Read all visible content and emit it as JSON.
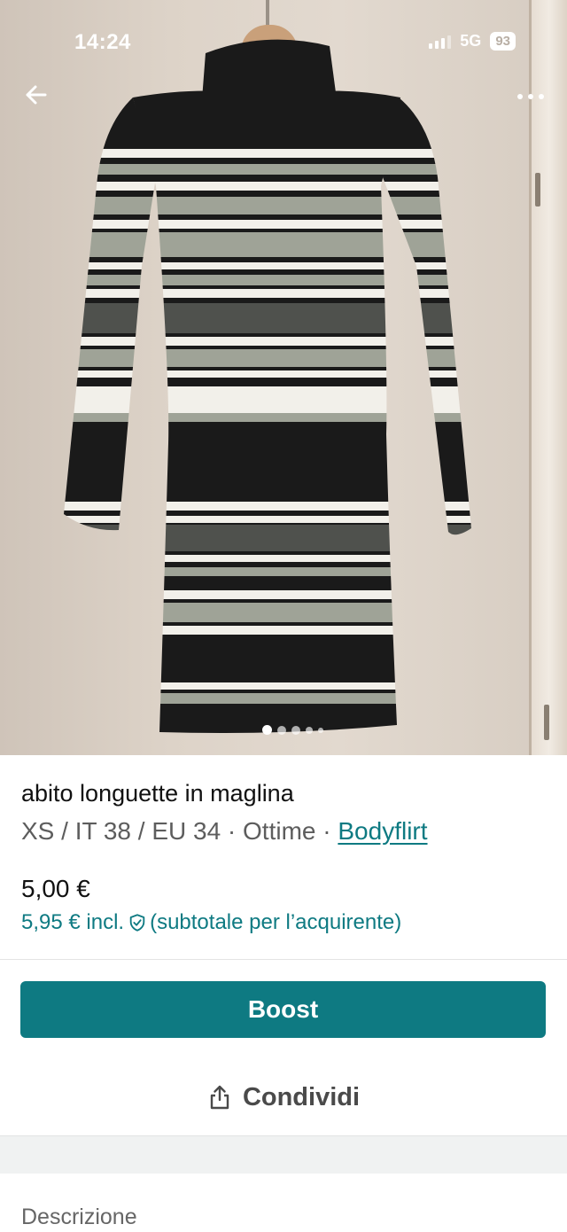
{
  "status_bar": {
    "time": "14:24",
    "network": "5G",
    "battery": "93"
  },
  "photo": {
    "subject": "striped ribbed turtleneck dress on hanger",
    "colors": {
      "black": "#1a1a1a",
      "white": "#f2f0ea",
      "sage_gray": "#9fa397",
      "dark_gray": "#4f514d",
      "wall": "#dcd2c7"
    },
    "gallery_dots_count": 5,
    "active_dot_index": 0
  },
  "nav": {
    "back_icon": "arrow-left-icon",
    "more_icon": "more-horizontal-icon"
  },
  "item": {
    "title": "abito longuette in maglina",
    "meta_prefix": "XS / IT 38 / EU 34 · Ottime · ",
    "brand": "Bodyflirt",
    "price": "5,00 €",
    "price_incl": "5,95 € incl.",
    "price_incl_note": "(subtotale per l’acquirente)"
  },
  "actions": {
    "boost_label": "Boost",
    "share_label": "Condividi"
  },
  "section": {
    "description_label": "Descrizione"
  },
  "theme": {
    "accent": "#0e7a82"
  }
}
